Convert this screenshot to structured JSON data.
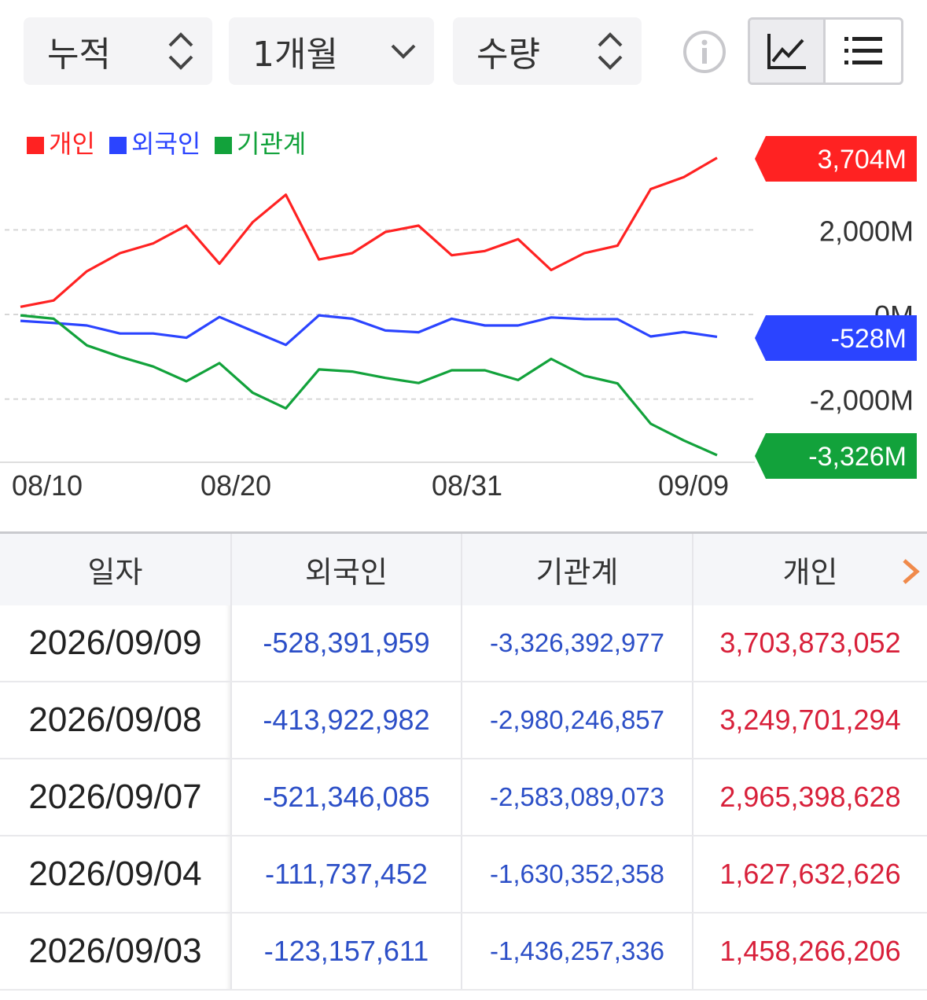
{
  "controls": {
    "cumulative_label": "누적",
    "period_label": "1개월",
    "quantity_label": "수량"
  },
  "chart_data": {
    "type": "line",
    "legend": [
      "개인",
      "외국인",
      "기관계"
    ],
    "x_ticks": [
      "08/10",
      "08/20",
      "08/31",
      "09/09"
    ],
    "y_ticks": [
      "2,000M",
      "0M",
      "-2,000M"
    ],
    "y_unit": "M",
    "ylim": [
      -3400,
      3704
    ],
    "grid": true,
    "colors": {
      "개인": "#ff2222",
      "외국인": "#2b44ff",
      "기관계": "#12a23b"
    },
    "series": [
      {
        "name": "개인",
        "values": [
          180,
          330,
          1020,
          1450,
          1680,
          2100,
          1200,
          2180,
          2830,
          1300,
          1450,
          1950,
          2100,
          1400,
          1500,
          1780,
          1050,
          1450,
          1627.6,
          2965.4,
          3249.7,
          3703.9
        ]
      },
      {
        "name": "외국인",
        "values": [
          -150,
          -200,
          -260,
          -450,
          -450,
          -550,
          -60,
          -390,
          -720,
          -20,
          -100,
          -380,
          -420,
          -100,
          -260,
          -260,
          -70,
          -110,
          -111.7,
          -521.3,
          -413.9,
          -528.4
        ]
      },
      {
        "name": "기관계",
        "values": [
          -20,
          -100,
          -730,
          -1000,
          -1230,
          -1580,
          -1150,
          -1850,
          -2220,
          -1300,
          -1350,
          -1500,
          -1620,
          -1320,
          -1320,
          -1550,
          -1050,
          -1450,
          -1630.4,
          -2583.1,
          -2980.2,
          -3326.4
        ]
      }
    ],
    "end_labels": {
      "개인": "3,704M",
      "외국인": "-528M",
      "기관계": "-3,326M"
    }
  },
  "table": {
    "headers": [
      "일자",
      "외국인",
      "기관계",
      "개인"
    ],
    "rows": [
      {
        "date": "2026/09/09",
        "foreign": "-528,391,959",
        "institution": "-3,326,392,977",
        "individual": "3,703,873,052"
      },
      {
        "date": "2026/09/08",
        "foreign": "-413,922,982",
        "institution": "-2,980,246,857",
        "individual": "3,249,701,294"
      },
      {
        "date": "2026/09/07",
        "foreign": "-521,346,085",
        "institution": "-2,583,089,073",
        "individual": "2,965,398,628"
      },
      {
        "date": "2026/09/04",
        "foreign": "-111,737,452",
        "institution": "-1,630,352,358",
        "individual": "1,627,632,626"
      },
      {
        "date": "2026/09/03",
        "foreign": "-123,157,611",
        "institution": "-1,436,257,336",
        "individual": "1,458,266,206"
      }
    ]
  }
}
